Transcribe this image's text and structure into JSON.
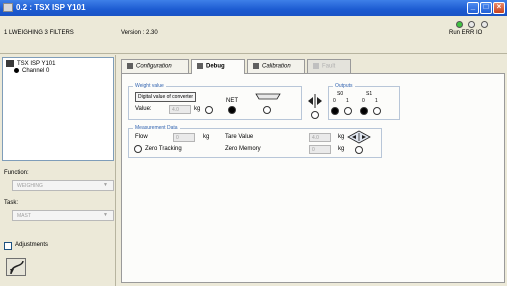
{
  "window": {
    "title": "0.2 : TSX ISP Y101"
  },
  "info": {
    "module_name": "1 LWEIGHING 3 FILTERS",
    "version": "Version : 2.30",
    "leds": [
      {
        "label": "Run",
        "state": "on",
        "color": "#3fc23f"
      },
      {
        "label": "ERR",
        "state": "off",
        "color": "#e8e8e8"
      },
      {
        "label": "IO",
        "state": "off",
        "color": "#e8e8e8"
      }
    ],
    "led_labels": "Run ERR IO"
  },
  "tree": {
    "root": "TSX ISP Y101",
    "child": "Channel 0"
  },
  "left": {
    "function_label": "Function:",
    "function_value": "WEIGHING",
    "task_label": "Task:",
    "task_value": "MAST",
    "adjustments_label": "Adjustments"
  },
  "tabs": [
    {
      "label": "Configuration",
      "state": "normal"
    },
    {
      "label": "Debug",
      "state": "active"
    },
    {
      "label": "Calibration",
      "state": "normal"
    },
    {
      "label": "Fault",
      "state": "disabled"
    }
  ],
  "weight": {
    "title": "Weight value",
    "digital_button": "Digital value of converter",
    "value_label": "Value:",
    "value": "4.0",
    "unit": "kg",
    "net_label": "NET"
  },
  "outputs": {
    "title": "Outputs",
    "s0_label": "S0",
    "s1_label": "S1",
    "bit_labels": [
      "0",
      "1",
      "0",
      "1"
    ]
  },
  "measurement": {
    "title": "Measurement Data",
    "flow_label": "Flow",
    "flow_value": "0",
    "flow_unit": "kg",
    "zero_tracking_label": "Zero Tracking",
    "tare_label": "Tare Value",
    "tare_value": "4.0",
    "tare_unit": "kg",
    "zero_memory_label": "Zero Memory",
    "zero_memory_value": "0",
    "zero_memory_unit": "kg"
  },
  "colors": {
    "titlebar": "#1c5bd1",
    "group_title": "#3264b0",
    "led_run": "#3fc23f"
  }
}
